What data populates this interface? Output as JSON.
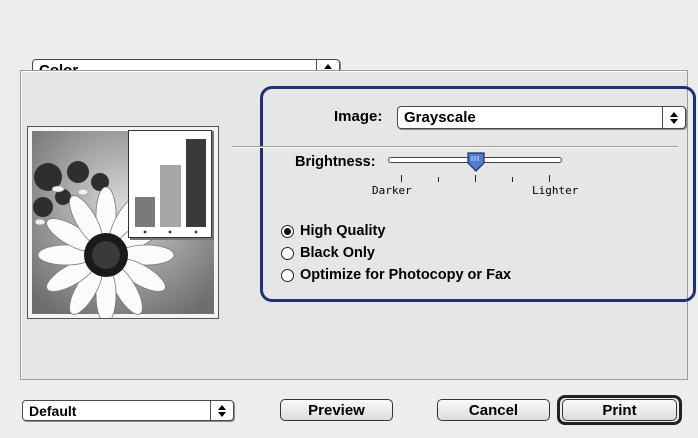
{
  "color_section": {
    "dropdown_value": "Color"
  },
  "image": {
    "label": "Image:",
    "value": "Grayscale"
  },
  "brightness": {
    "label": "Brightness:",
    "darker": "Darker",
    "lighter": "Lighter",
    "level": 0.5
  },
  "quality_options": [
    {
      "label": "High Quality",
      "selected": true
    },
    {
      "label": "Black Only",
      "selected": false
    },
    {
      "label": "Optimize for Photocopy or Fax",
      "selected": false
    }
  ],
  "footer": {
    "preset_value": "Default",
    "preview_label": "Preview",
    "cancel_label": "Cancel",
    "print_label": "Print"
  },
  "colors": {
    "highlight_border": "#1f2f7a",
    "slider_thumb": "#4a7fd0"
  }
}
